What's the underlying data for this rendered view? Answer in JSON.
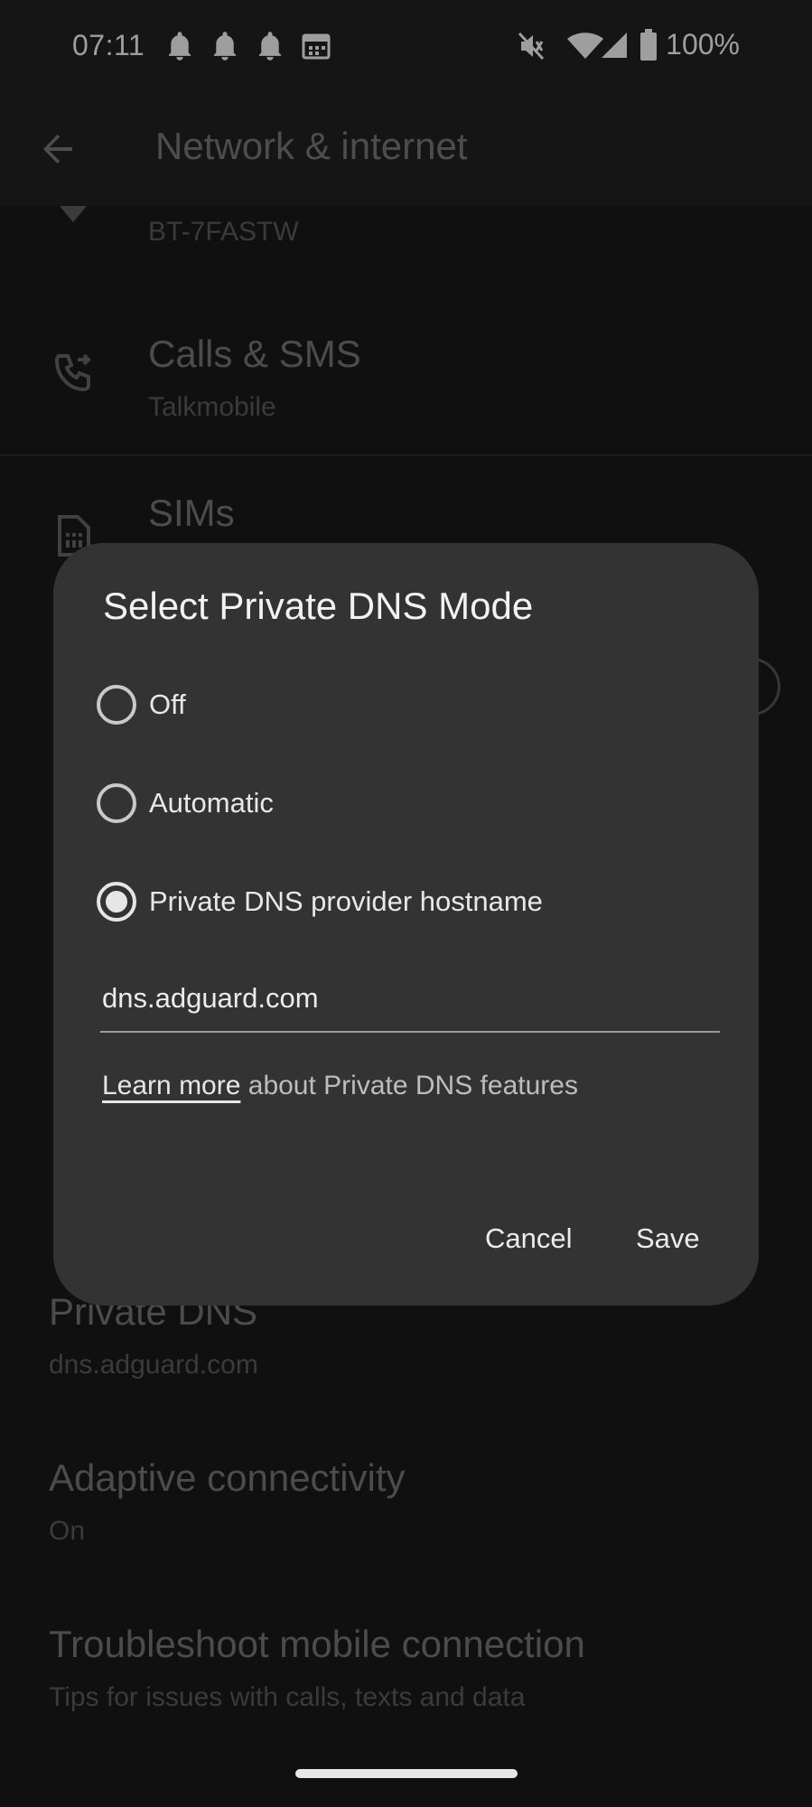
{
  "status_bar": {
    "time": "07:11",
    "battery_percent": "100%",
    "icons": [
      "bell-icon",
      "bell-icon",
      "bell-icon",
      "calendar-icon",
      "vibrate-off-icon",
      "wifi-icon",
      "signal-icon",
      "battery-icon"
    ]
  },
  "app_bar": {
    "title": "Network & internet",
    "back_icon": "arrow-back-icon"
  },
  "list": {
    "partial_row_sub": "BT-7FASTW",
    "calls_title": "Calls & SMS",
    "calls_sub": "Talkmobile",
    "sims_title": "SIMs",
    "private_dns_title": "Private DNS",
    "private_dns_sub": "dns.adguard.com",
    "adaptive_title": "Adaptive connectivity",
    "adaptive_sub": "On",
    "troubleshoot_title": "Troubleshoot mobile connection",
    "troubleshoot_sub": "Tips for issues with calls, texts and data"
  },
  "dialog": {
    "title": "Select Private DNS Mode",
    "options": [
      {
        "label": "Off",
        "selected": false
      },
      {
        "label": "Automatic",
        "selected": false
      },
      {
        "label": "Private DNS provider hostname",
        "selected": true
      }
    ],
    "hostname_value": "dns.adguard.com",
    "learn_more_link": "Learn more",
    "learn_more_rest": " about Private DNS features",
    "cancel_label": "Cancel",
    "save_label": "Save"
  },
  "colors": {
    "dialog_bg": "#333333",
    "screen_bg": "#1a1a1a",
    "text_primary": "#e6e6e6"
  }
}
